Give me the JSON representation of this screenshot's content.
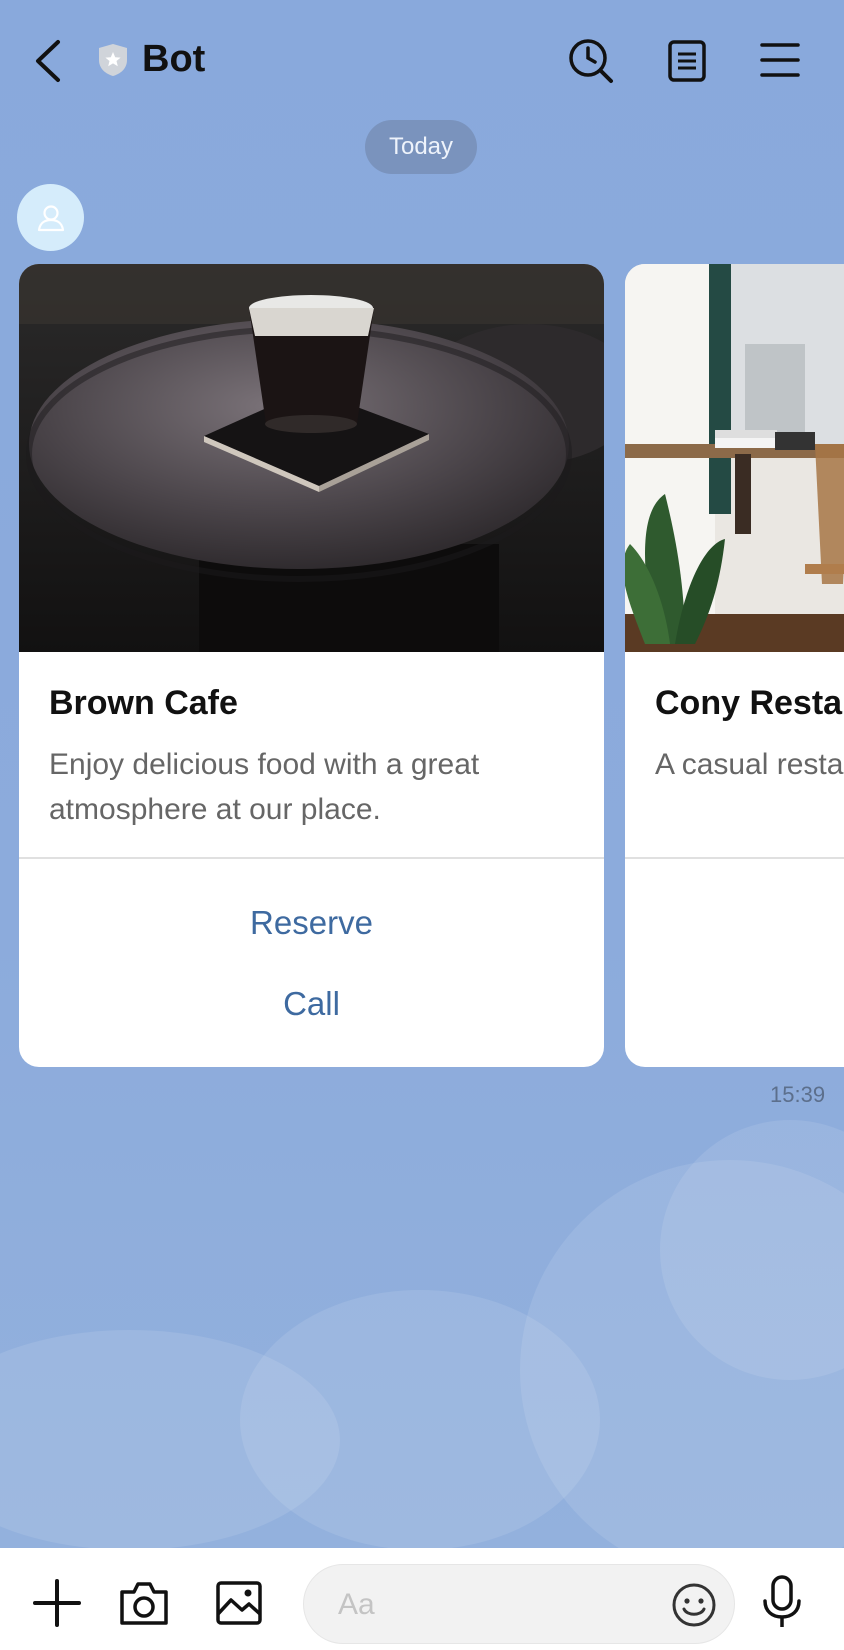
{
  "header": {
    "title": "Bot",
    "back_icon": "chevron-left-icon",
    "badge_icon": "shield-star-icon",
    "actions": [
      "search-history-icon",
      "notes-icon",
      "menu-icon"
    ]
  },
  "chat": {
    "date_label": "Today",
    "timestamp": "15:39",
    "cards": [
      {
        "title": "Brown Cafe",
        "description": "Enjoy delicious food with a great atmosphere at our place.",
        "actions": [
          "Reserve",
          "Call"
        ]
      },
      {
        "title": "Cony Resta",
        "description": "A casual resta time."
      }
    ]
  },
  "composer": {
    "placeholder": "Aa",
    "icons": [
      "plus-icon",
      "camera-icon",
      "image-icon",
      "emoji-icon",
      "microphone-icon"
    ]
  },
  "colors": {
    "background": "#8eaddb",
    "action_text": "#3e6aa0",
    "date_pill": "#7a93bd",
    "avatar": "#d5ecfb"
  }
}
